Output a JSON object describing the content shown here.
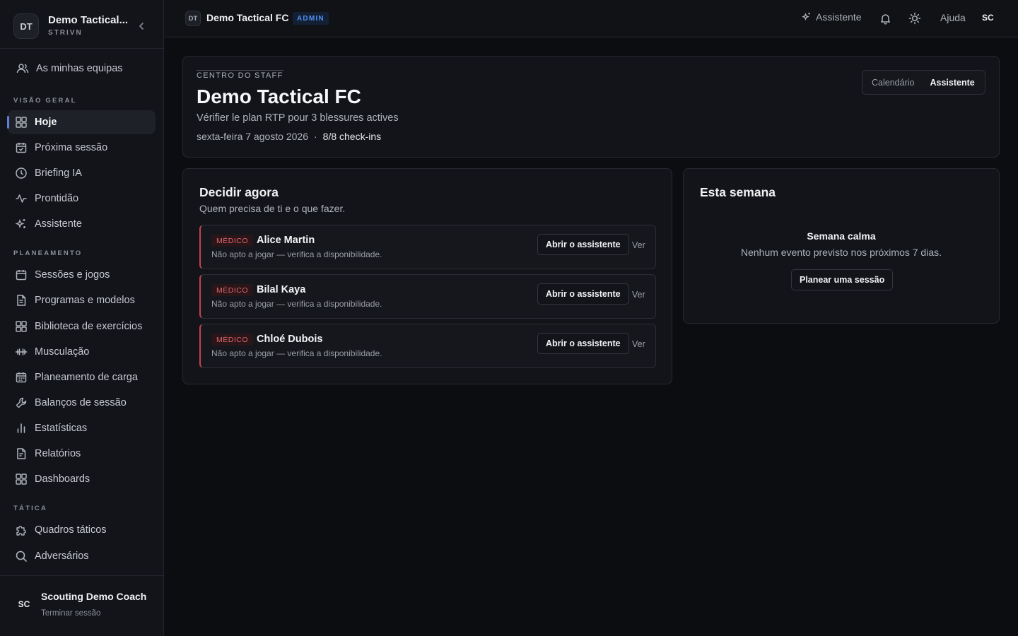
{
  "sidebar": {
    "team_avatar": "DT",
    "team_name": "Demo Tactical...",
    "team_sub": "STRIVN",
    "my_teams": "As minhas equipas",
    "sections": {
      "overview": "VISÃO GERAL",
      "planning": "PLANEAMENTO",
      "tactics": "TÁTICA"
    },
    "items": [
      {
        "label": "Hoje",
        "icon": "grid-icon"
      },
      {
        "label": "Próxima sessão",
        "icon": "calendar-check-icon"
      },
      {
        "label": "Briefing IA",
        "icon": "clock-icon"
      },
      {
        "label": "Prontidão",
        "icon": "activity-icon"
      },
      {
        "label": "Assistente",
        "icon": "sparkles-icon"
      },
      {
        "label": "Sessões e jogos",
        "icon": "calendar-icon"
      },
      {
        "label": "Programas e modelos",
        "icon": "document-icon"
      },
      {
        "label": "Biblioteca de exercícios",
        "icon": "grid-icon"
      },
      {
        "label": "Musculação",
        "icon": "dumbbell-icon"
      },
      {
        "label": "Planeamento de carga",
        "icon": "calendar-grid-icon"
      },
      {
        "label": "Balanços de sessão",
        "icon": "wrench-icon"
      },
      {
        "label": "Estatísticas",
        "icon": "bar-chart-icon"
      },
      {
        "label": "Relatórios",
        "icon": "report-icon"
      },
      {
        "label": "Dashboards",
        "icon": "grid-icon"
      },
      {
        "label": "Quadros táticos",
        "icon": "puzzle-icon"
      },
      {
        "label": "Adversários",
        "icon": "search-icon"
      }
    ],
    "user_avatar": "SC",
    "user_name": "Scouting Demo Coach",
    "logout": "Terminar sessão"
  },
  "topbar": {
    "avatar": "DT",
    "title": "Demo Tactical FC",
    "badge": "ADMIN",
    "assistant": "Assistente",
    "help": "Ajuda",
    "user": "SC"
  },
  "hero": {
    "eyebrow": "CENTRO DO STAFF",
    "title": "Demo Tactical FC",
    "subtitle": "Vérifier le plan RTP pour 3 blessures actives",
    "date": "sexta-feira 7 agosto 2026",
    "separator": "·",
    "checkins": "8/8 check-ins",
    "tabs": [
      "Calendário",
      "Assistente"
    ]
  },
  "decide": {
    "title": "Decidir agora",
    "subtitle": "Quem precisa de ti e o que fazer.",
    "rows": [
      {
        "tag": "MÉDICO",
        "name": "Alice Martin",
        "desc": "Não apto a jogar — verifica a disponibilidade.",
        "action": "Abrir o assistente",
        "link": "Ver"
      },
      {
        "tag": "MÉDICO",
        "name": "Bilal Kaya",
        "desc": "Não apto a jogar — verifica a disponibilidade.",
        "action": "Abrir o assistente",
        "link": "Ver"
      },
      {
        "tag": "MÉDICO",
        "name": "Chloé Dubois",
        "desc": "Não apto a jogar — verifica a disponibilidade.",
        "action": "Abrir o assistente",
        "link": "Ver"
      }
    ]
  },
  "week": {
    "title": "Esta semana",
    "empty_title": "Semana calma",
    "empty_sub": "Nenhum evento previsto nos próximos 7 dias.",
    "action": "Planear uma sessão"
  },
  "colors": {
    "background": "#0c0d10",
    "panel": "#121419",
    "accent_blue": "#4f8ff0",
    "medical_red": "#c4434f"
  }
}
